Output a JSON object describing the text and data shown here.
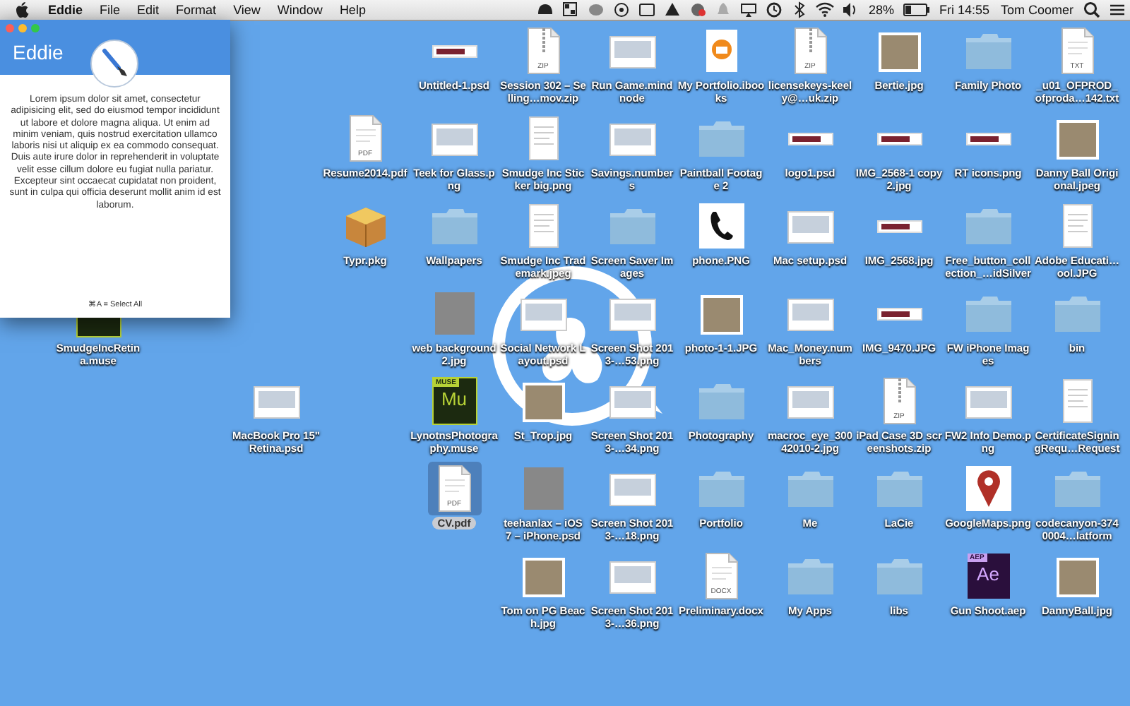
{
  "menu_bar": {
    "app_name": "Eddie",
    "items": [
      "File",
      "Edit",
      "Format",
      "View",
      "Window",
      "Help"
    ],
    "battery_percent": "28%",
    "clock": "Fri 14:55",
    "user": "Tom Coomer"
  },
  "window": {
    "title": "Eddie",
    "body": "Lorem ipsum dolor sit amet, consectetur adipisicing elit, sed do eiusmod tempor incididunt ut labore et dolore magna aliqua. Ut enim ad minim veniam, quis nostrud exercitation ullamco laboris nisi ut aliquip ex ea commodo consequat. Duis aute irure dolor in reprehenderit in voluptate velit esse cillum dolore eu fugiat nulla pariatur. Excepteur sint occaecat cupidatat non proident, sunt in culpa qui officia deserunt mollit anim id est laborum.",
    "hint": "⌘A = Select All"
  },
  "desktop": {
    "rows": [
      [
        null,
        null,
        null,
        null,
        {
          "label": "Untitled-1.psd",
          "kind": "banner",
          "selected": false
        },
        {
          "label": "Session 302 – Selling…mov.zip",
          "kind": "doc",
          "badge": "ZIP",
          "selected": false
        },
        {
          "label": "Run Game.mindnode",
          "kind": "screenshot",
          "selected": false
        },
        {
          "label": "My Portfolio.ibooks",
          "kind": "ibooks",
          "selected": false
        },
        {
          "label": "licensekeys-keely@…uk.zip",
          "kind": "doc",
          "badge": "ZIP",
          "selected": false
        },
        {
          "label": "Bertie.jpg",
          "kind": "photo",
          "selected": false
        },
        {
          "label": "Family Photo",
          "kind": "folder",
          "selected": false
        },
        {
          "label": "_u01_OFPROD_ofproda…142.txt",
          "kind": "doc",
          "badge": "TXT",
          "selected": false
        }
      ],
      [
        null,
        null,
        null,
        {
          "label": "Resume2014.pdf",
          "kind": "doc",
          "badge": "PDF",
          "selected": false
        },
        {
          "label": "Teek for Glass.png",
          "kind": "screenshot",
          "selected": false
        },
        {
          "label": "Smudge Inc Sticker big.png",
          "kind": "page",
          "selected": false
        },
        {
          "label": "Savings.numbers",
          "kind": "screenshot",
          "selected": false
        },
        {
          "label": "Paintball Footage 2",
          "kind": "folder",
          "selected": false
        },
        {
          "label": "logo1.psd",
          "kind": "banner",
          "selected": false
        },
        {
          "label": "IMG_2568-1 copy2.jpg",
          "kind": "banner",
          "selected": false
        },
        {
          "label": "RT icons.png",
          "kind": "banner",
          "selected": false
        },
        {
          "label": "Danny Ball Origional.jpeg",
          "kind": "photo",
          "selected": false
        }
      ],
      [
        null,
        null,
        null,
        {
          "label": "Typr.pkg",
          "kind": "package",
          "selected": false
        },
        {
          "label": "Wallpapers",
          "kind": "folder",
          "selected": false
        },
        {
          "label": "Smudge Inc Trademark.jpeg",
          "kind": "page",
          "selected": false
        },
        {
          "label": "Screen Saver Images",
          "kind": "folder",
          "selected": false
        },
        {
          "label": "phone.PNG",
          "kind": "phone",
          "selected": false
        },
        {
          "label": "Mac setup.psd",
          "kind": "screenshot",
          "selected": false
        },
        {
          "label": "IMG_2568.jpg",
          "kind": "banner",
          "selected": false
        },
        {
          "label": "Free_button_collection_…idSilver",
          "kind": "folder",
          "selected": false
        },
        {
          "label": "Adobe Educati…ool.JPG",
          "kind": "page",
          "selected": false
        }
      ],
      [
        {
          "label": "SmudgeIncRetina.muse",
          "kind": "muse",
          "selected": false
        },
        null,
        null,
        null,
        {
          "label": "web background2.jpg",
          "kind": "gray",
          "selected": false
        },
        {
          "label": "Social Network Layout.psd",
          "kind": "screenshot",
          "selected": false
        },
        {
          "label": "Screen Shot 2013-…53.png",
          "kind": "screenshot",
          "selected": false
        },
        {
          "label": "photo-1-1.JPG",
          "kind": "photo",
          "selected": false
        },
        {
          "label": "Mac_Money.numbers",
          "kind": "screenshot",
          "selected": false
        },
        {
          "label": "IMG_9470.JPG",
          "kind": "banner",
          "selected": false
        },
        {
          "label": "FW iPhone Images",
          "kind": "folder",
          "selected": false
        },
        {
          "label": "bin",
          "kind": "folder",
          "selected": false
        }
      ],
      [
        null,
        null,
        {
          "label": "MacBook Pro 15\" Retina.psd",
          "kind": "screenshot",
          "selected": false
        },
        null,
        {
          "label": "LynotnsPhotography.muse",
          "kind": "muse",
          "badge": "MUSE",
          "mark": "Mu",
          "selected": false
        },
        {
          "label": "St_Trop.jpg",
          "kind": "photo",
          "selected": false
        },
        {
          "label": "Screen Shot 2013-…34.png",
          "kind": "screenshot",
          "selected": false
        },
        {
          "label": "Photography",
          "kind": "folder",
          "selected": false
        },
        {
          "label": "macroc_eye_30042010-2.jpg",
          "kind": "screenshot",
          "selected": false
        },
        {
          "label": "iPad Case 3D screenshots.zip",
          "kind": "doc",
          "badge": "ZIP",
          "selected": false
        },
        {
          "label": "FW2 Info Demo.png",
          "kind": "screenshot",
          "selected": false
        },
        {
          "label": "CertificateSigningRequ…Request",
          "kind": "page",
          "selected": false
        }
      ],
      [
        null,
        null,
        null,
        null,
        {
          "label": "CV.pdf",
          "kind": "doc",
          "badge": "PDF",
          "selected": true
        },
        {
          "label": "teehanlax – iOS 7 – iPhone.psd",
          "kind": "gray",
          "selected": false
        },
        {
          "label": "Screen Shot 2013-…18.png",
          "kind": "screenshot",
          "selected": false
        },
        {
          "label": "Portfolio",
          "kind": "folder",
          "selected": false
        },
        {
          "label": "Me",
          "kind": "folder",
          "selected": false
        },
        {
          "label": "LaCie",
          "kind": "folder",
          "selected": false
        },
        {
          "label": "GoogleMaps.png",
          "kind": "map",
          "selected": false
        },
        {
          "label": "codecanyon-3740004…latform",
          "kind": "folder",
          "selected": false
        }
      ],
      [
        null,
        null,
        null,
        null,
        null,
        {
          "label": "Tom on PG Beach.jpg",
          "kind": "photo",
          "selected": false
        },
        {
          "label": "Screen Shot 2013-…36.png",
          "kind": "screenshot",
          "selected": false
        },
        {
          "label": "Preliminary.docx",
          "kind": "doc",
          "badge": "DOCX",
          "selected": false
        },
        {
          "label": "My Apps",
          "kind": "folder",
          "selected": false
        },
        {
          "label": "libs",
          "kind": "folder",
          "selected": false
        },
        {
          "label": "Gun Shoot.aep",
          "kind": "aep",
          "badge": "AEP",
          "mark": "Ae",
          "selected": false
        },
        {
          "label": "DannyBall.jpg",
          "kind": "photo",
          "selected": false
        }
      ]
    ]
  }
}
